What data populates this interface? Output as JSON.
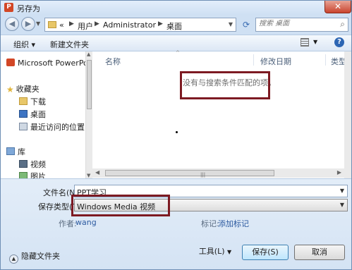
{
  "window": {
    "title": "另存为",
    "close_label": "✕",
    "app_icon": "P"
  },
  "address": {
    "crumbs": [
      "«",
      "用户",
      "Administrator",
      "桌面"
    ],
    "search_placeholder": "搜索 桌面"
  },
  "toolbar": {
    "organize_label": "组织 ▾",
    "new_folder_label": "新建文件夹",
    "help_label": "?"
  },
  "sidebar": {
    "items": [
      {
        "label": "Microsoft PowerPo",
        "icon": "powerpoint-icon"
      },
      {
        "label": "收藏夹",
        "icon": "star-icon"
      },
      {
        "label": "下载",
        "icon": "download-folder-icon"
      },
      {
        "label": "桌面",
        "icon": "desktop-icon"
      },
      {
        "label": "最近访问的位置",
        "icon": "recent-places-icon"
      },
      {
        "label": "库",
        "icon": "library-icon"
      },
      {
        "label": "视频",
        "icon": "video-icon"
      },
      {
        "label": "图片",
        "icon": "pictures-icon"
      }
    ]
  },
  "file_list": {
    "columns": [
      "名称",
      "修改日期",
      "类型"
    ],
    "empty_message": "没有与搜索条件匹配的项。"
  },
  "form": {
    "filename_label": "文件名(N):",
    "filename_value": "PPT学习",
    "filetype_label": "保存类型(T):",
    "filetype_value": "Windows Media 视频",
    "author_label": "作者:",
    "author_value": "wang",
    "tags_label": "标记:",
    "tags_value": "添加标记",
    "hide_folders_label": "隐藏文件夹",
    "tools_label": "工具(L)",
    "save_label": "保存(S)",
    "cancel_label": "取消"
  },
  "colors": {
    "highlight_box": "#7d1a22",
    "accent": "#3c7fb1"
  }
}
